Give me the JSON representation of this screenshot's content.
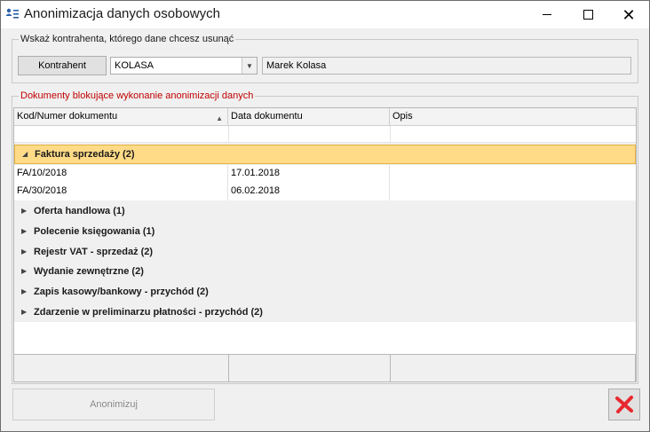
{
  "window": {
    "title": "Anonimizacja danych osobowych",
    "close_glyph": "✕"
  },
  "contractor_group": {
    "legend": "Wskaż kontrahenta, którego dane chcesz usunąć",
    "button_label": "Kontrahent",
    "combo_value": "KOLASA",
    "combo_arrow": "▼",
    "name_value": "Marek Kolasa"
  },
  "documents_group": {
    "legend": "Dokumenty blokujące wykonanie anonimizacji danych",
    "legend_color": "#c00000",
    "columns": [
      "Kod/Numer dokumentu",
      "Data dokumentu",
      "Opis"
    ],
    "sort_arrow": "▲",
    "groups": [
      {
        "label": "Faktura sprzedaży (2)",
        "arrow": "◢",
        "expanded": true,
        "selected": true
      },
      {
        "label": "Oferta handlowa (1)",
        "arrow": "▶",
        "expanded": false
      },
      {
        "label": "Polecenie księgowania (1)",
        "arrow": "▶",
        "expanded": false
      },
      {
        "label": "Rejestr VAT - sprzedaż (2)",
        "arrow": "▶",
        "expanded": false
      },
      {
        "label": "Wydanie zewnętrzne (2)",
        "arrow": "▶",
        "expanded": false
      },
      {
        "label": "Zapis kasowy/bankowy - przychód (2)",
        "arrow": "▶",
        "expanded": false
      },
      {
        "label": "Zdarzenie w preliminarzu płatności - przychód (2)",
        "arrow": "▶",
        "expanded": false
      }
    ],
    "rows": [
      {
        "number": "FA/10/2018",
        "date": "17.01.2018",
        "description": ""
      },
      {
        "number": "FA/30/2018",
        "date": "06.02.2018",
        "description": ""
      }
    ],
    "selected_group_color": "#ffdb87"
  },
  "actions": {
    "anonymize_label": "Anonimizuj",
    "anonymize_enabled": false,
    "cancel_icon": "red-x-icon",
    "cancel_color": "#e8282e"
  }
}
